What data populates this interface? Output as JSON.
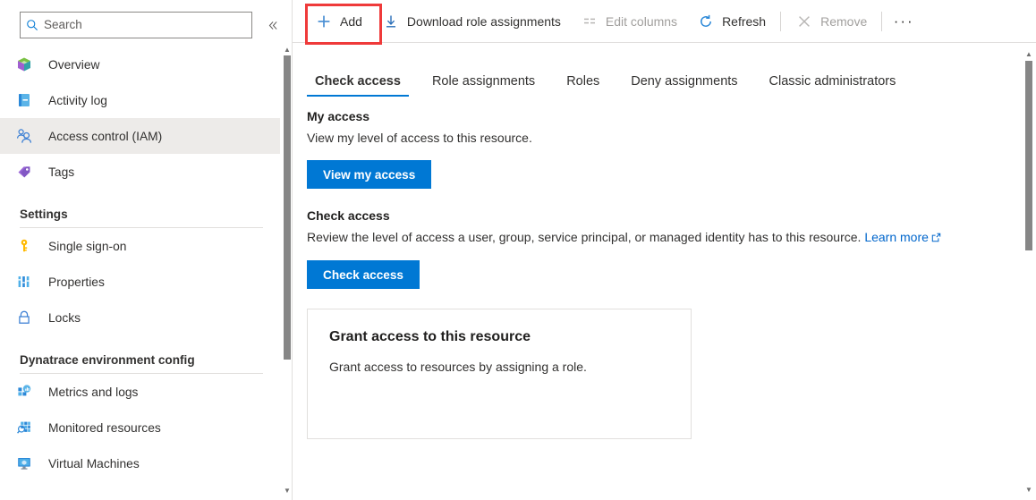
{
  "sidebar": {
    "search": {
      "placeholder": "Search",
      "value": "",
      "icon": "search-icon"
    },
    "collapse_label": "«",
    "items": [
      {
        "label": "Overview",
        "icon": "overview-cube-icon",
        "selected": false
      },
      {
        "label": "Activity log",
        "icon": "activity-log-book-icon",
        "selected": false
      },
      {
        "label": "Access control (IAM)",
        "icon": "access-control-people-icon",
        "selected": true
      },
      {
        "label": "Tags",
        "icon": "tags-icon",
        "selected": false
      }
    ],
    "sections": [
      {
        "title": "Settings",
        "items": [
          {
            "label": "Single sign-on",
            "icon": "key-icon"
          },
          {
            "label": "Properties",
            "icon": "properties-bars-icon"
          },
          {
            "label": "Locks",
            "icon": "lock-icon"
          }
        ]
      },
      {
        "title": "Dynatrace environment config",
        "items": [
          {
            "label": "Metrics and logs",
            "icon": "metrics-logs-icon"
          },
          {
            "label": "Monitored resources",
            "icon": "monitored-resources-icon"
          },
          {
            "label": "Virtual Machines",
            "icon": "virtual-machine-icon"
          }
        ]
      }
    ],
    "scrollbar": {
      "up_arrow": "▲",
      "down_arrow": "▼"
    }
  },
  "toolbar": {
    "items": [
      {
        "label": "Add",
        "icon": "plus-icon",
        "disabled": false,
        "highlighted": true
      },
      {
        "label": "Download role assignments",
        "icon": "download-icon",
        "disabled": false,
        "highlighted": false
      },
      {
        "label": "Edit columns",
        "icon": "columns-icon",
        "disabled": true,
        "highlighted": false
      },
      {
        "label": "Refresh",
        "icon": "refresh-icon",
        "disabled": false,
        "highlighted": false
      },
      {
        "label": "Remove",
        "icon": "close-x-icon",
        "disabled": true,
        "highlighted": false
      }
    ],
    "overflow_label": "···",
    "highlight_color": "#ef3a3a"
  },
  "tabs": [
    {
      "label": "Check access",
      "active": true
    },
    {
      "label": "Role assignments",
      "active": false
    },
    {
      "label": "Roles",
      "active": false
    },
    {
      "label": "Deny assignments",
      "active": false
    },
    {
      "label": "Classic administrators",
      "active": false
    }
  ],
  "main": {
    "my_access": {
      "heading": "My access",
      "description": "View my level of access to this resource.",
      "button": "View my access"
    },
    "check_access": {
      "heading": "Check access",
      "description": "Review the level of access a user, group, service principal, or managed identity has to this resource.",
      "link_text": "Learn more",
      "button": "Check access"
    },
    "grant_card": {
      "title": "Grant access to this resource",
      "description": "Grant access to resources by assigning a role."
    },
    "scrollbar": {
      "up_arrow": "▲",
      "down_arrow": "▼"
    }
  },
  "colors": {
    "accent": "#0078d4",
    "link": "#0066cc",
    "selected_bg": "#edebe9",
    "border": "#e1dfdd",
    "highlight": "#ef3a3a"
  }
}
